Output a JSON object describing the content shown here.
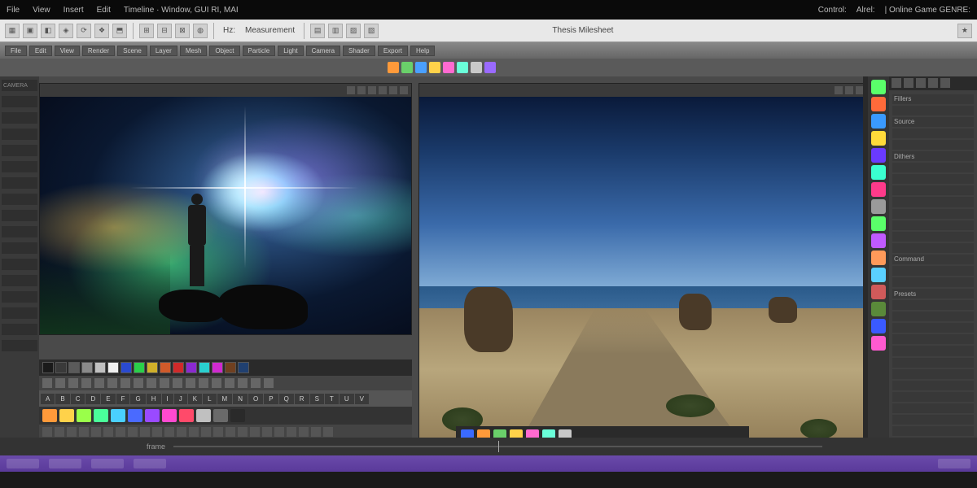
{
  "menu": {
    "items": [
      "File",
      "View",
      "Insert",
      "Edit",
      "Timeline · Window, GUI RI, MAI"
    ],
    "right": [
      "Control:",
      "Alrel:",
      "| Online  Game GENRE:"
    ]
  },
  "toolbar1": {
    "label_a": "Hz:",
    "label_b": "Measurement",
    "center": "Thesis Milesheet"
  },
  "ribbon": {
    "chips": [
      "File",
      "Edit",
      "View",
      "Render",
      "Scene",
      "Layer",
      "Mesh",
      "Object",
      "Particle",
      "Light",
      "Camera",
      "Shader",
      "Export",
      "Help"
    ]
  },
  "midbar": {
    "colors": [
      "#ff9a3a",
      "#6ad06a",
      "#4aa0ff",
      "#ffd24a",
      "#ff6ad0",
      "#6affd9",
      "#c9c9c9",
      "#9a6aff"
    ]
  },
  "left_items": [
    "CAMERA",
    "",
    "",
    "",
    "",
    "",
    "",
    "",
    "",
    "",
    "",
    "",
    "",
    "",
    "",
    "",
    ""
  ],
  "palette": [
    "#1a1a1a",
    "#3a3a3a",
    "#5a5a5a",
    "#8a8a8a",
    "#c0c0c0",
    "#f0f0f0",
    "#2a4ad0",
    "#2ad04a",
    "#d0b02a",
    "#d05a2a",
    "#d02a2a",
    "#8a2ad0",
    "#2ad0d0",
    "#d02ad0",
    "#704020",
    "#204070"
  ],
  "proptabs": [
    "A",
    "B",
    "C",
    "D",
    "E",
    "F",
    "G",
    "H",
    "I",
    "J",
    "K",
    "L",
    "M",
    "N",
    "O",
    "P",
    "Q",
    "R",
    "S",
    "T",
    "U",
    "V"
  ],
  "colortabs": [
    "#ff9a3a",
    "#ffd24a",
    "#9aff4a",
    "#4aff9a",
    "#4ad0ff",
    "#4a6aff",
    "#9a4aff",
    "#ff4ad0",
    "#ff4a6a",
    "#c0c0c0",
    "#6a6a6a",
    "#2a2a2a"
  ],
  "taskR": [
    "#3a6aff",
    "#ff9a3a",
    "#6ad06a",
    "#ffd24a",
    "#ff6ad0",
    "#6affd9",
    "#c9c9c9"
  ],
  "right_icons": [
    "#5aff6a",
    "#ff6a3a",
    "#3a9aff",
    "#ffda3a",
    "#6a3aff",
    "#3affd0",
    "#ff3a8a",
    "#9a9a9a",
    "#5aff6a",
    "#c05aff",
    "#ff9a5a",
    "#5ad0ff",
    "#d05a5a",
    "#5a8a3a",
    "#3a5aff",
    "#ff5ad0"
  ],
  "right_list": [
    "Fillers",
    "",
    "Source",
    "",
    "",
    "Dithers",
    "",
    "",
    "",
    "",
    "",
    "",
    "",
    "",
    "Command",
    "",
    "",
    "Presets",
    "",
    "",
    "",
    "",
    "",
    "",
    "",
    "",
    "",
    "",
    "",
    ""
  ],
  "timeline": {
    "label": "frame"
  }
}
